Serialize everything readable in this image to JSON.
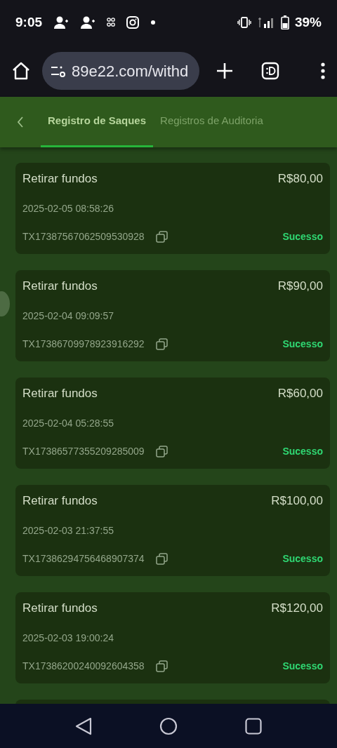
{
  "status_bar": {
    "time": "9:05",
    "battery": "39%"
  },
  "browser": {
    "url": "89e22.com/withd"
  },
  "tabs": [
    {
      "label": "Registro de Saques",
      "selected": true
    },
    {
      "label": "Registros de Auditoria",
      "selected": false
    }
  ],
  "records": [
    {
      "title": "Retirar fundos",
      "amount": "R$80,00",
      "date": "2025-02-05 08:58:26",
      "tx": "TX17387567062509530928",
      "status": "Sucesso"
    },
    {
      "title": "Retirar fundos",
      "amount": "R$90,00",
      "date": "2025-02-04 09:09:57",
      "tx": "TX17386709978923916292",
      "status": "Sucesso"
    },
    {
      "title": "Retirar fundos",
      "amount": "R$60,00",
      "date": "2025-02-04 05:28:55",
      "tx": "TX17386577355209285009",
      "status": "Sucesso"
    },
    {
      "title": "Retirar fundos",
      "amount": "R$100,00",
      "date": "2025-02-03 21:37:55",
      "tx": "TX17386294756468907374",
      "status": "Sucesso"
    },
    {
      "title": "Retirar fundos",
      "amount": "R$120,00",
      "date": "2025-02-03 19:00:24",
      "tx": "TX17386200240092604358",
      "status": "Sucesso"
    }
  ]
}
